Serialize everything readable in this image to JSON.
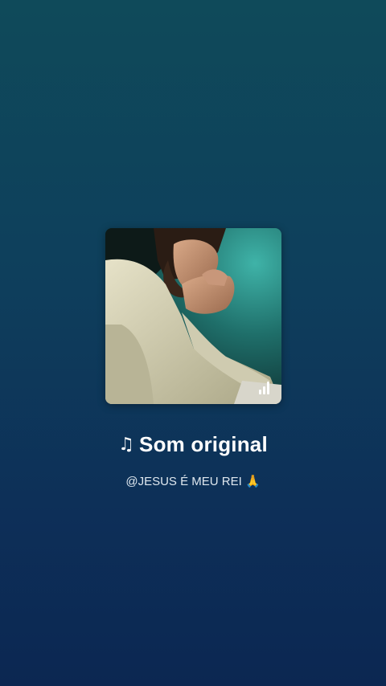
{
  "sound": {
    "note_icon": "music-note-icon",
    "note_glyph": "♫",
    "title": "Som original",
    "author": "@JESUS É MEU REI 🙏"
  },
  "artwork": {
    "subject": "praying-figure-image",
    "overlay_icon": "equalizer-bars-icon"
  },
  "colors": {
    "background_top": "#0f4a5a",
    "background_bottom": "#0c2752",
    "text_primary": "#ffffff",
    "text_secondary": "#dfe8ef"
  }
}
